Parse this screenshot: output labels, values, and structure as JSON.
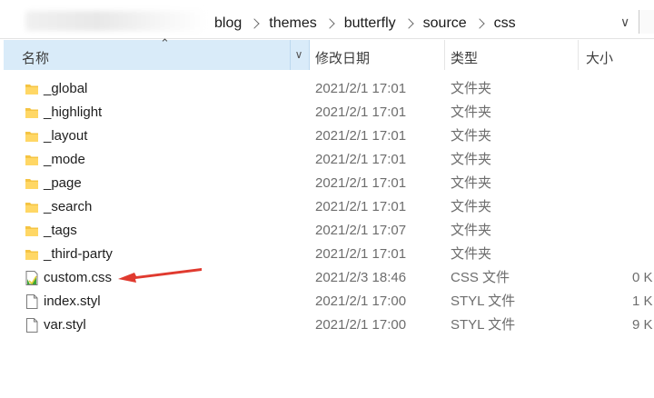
{
  "address": {
    "crumbs": [
      "blog",
      "themes",
      "butterfly",
      "source",
      "css"
    ]
  },
  "columns": {
    "name": "名称",
    "date": "修改日期",
    "type": "类型",
    "size": "大小"
  },
  "files": [
    {
      "name": "_global",
      "date": "2021/2/1 17:01",
      "type": "文件夹",
      "size": "",
      "icon": "folder-icon"
    },
    {
      "name": "_highlight",
      "date": "2021/2/1 17:01",
      "type": "文件夹",
      "size": "",
      "icon": "folder-icon"
    },
    {
      "name": "_layout",
      "date": "2021/2/1 17:01",
      "type": "文件夹",
      "size": "",
      "icon": "folder-icon"
    },
    {
      "name": "_mode",
      "date": "2021/2/1 17:01",
      "type": "文件夹",
      "size": "",
      "icon": "folder-icon"
    },
    {
      "name": "_page",
      "date": "2021/2/1 17:01",
      "type": "文件夹",
      "size": "",
      "icon": "folder-icon"
    },
    {
      "name": "_search",
      "date": "2021/2/1 17:01",
      "type": "文件夹",
      "size": "",
      "icon": "folder-icon"
    },
    {
      "name": "_tags",
      "date": "2021/2/1 17:07",
      "type": "文件夹",
      "size": "",
      "icon": "folder-icon"
    },
    {
      "name": "_third-party",
      "date": "2021/2/1 17:01",
      "type": "文件夹",
      "size": "",
      "icon": "folder-icon"
    },
    {
      "name": "custom.css",
      "date": "2021/2/3 18:46",
      "type": "CSS 文件",
      "size": "0 K",
      "icon": "css-file-icon"
    },
    {
      "name": "index.styl",
      "date": "2021/2/1 17:00",
      "type": "STYL 文件",
      "size": "1 K",
      "icon": "blank-file-icon"
    },
    {
      "name": "var.styl",
      "date": "2021/2/1 17:00",
      "type": "STYL 文件",
      "size": "9 K",
      "icon": "blank-file-icon"
    }
  ],
  "colors": {
    "header_selected": "#d9ebf9",
    "folder": "#f5c443",
    "arrow": "#e03a2f"
  }
}
